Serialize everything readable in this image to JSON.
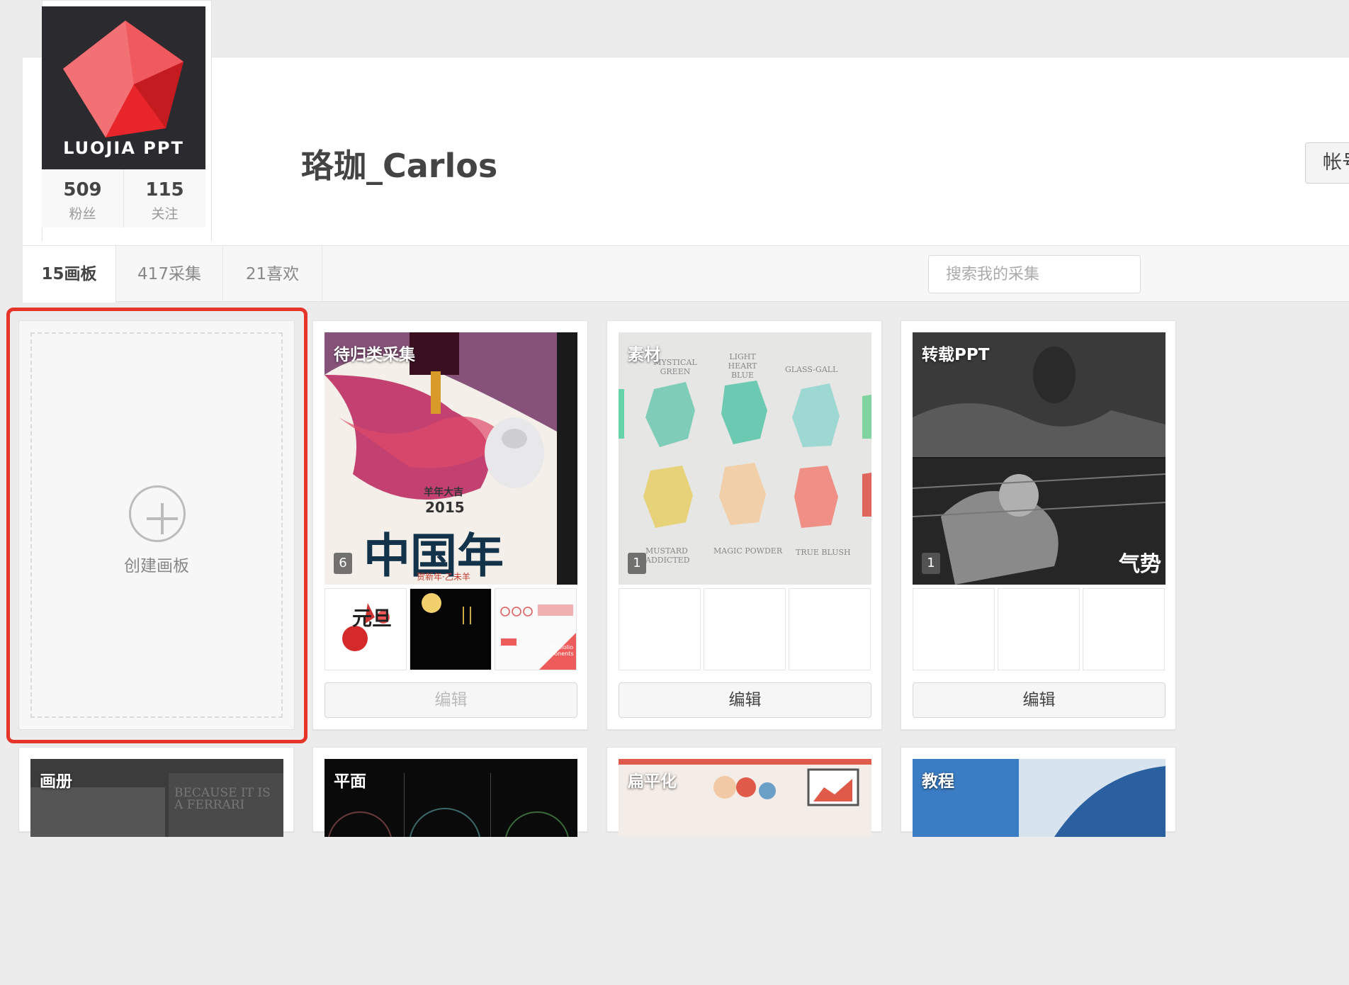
{
  "profile": {
    "username": "珞珈_Carlos",
    "avatar_text": "LUOJIA PPT",
    "followers_count": "509",
    "followers_label": "粉丝",
    "following_count": "115",
    "following_label": "关注",
    "account_button": "帐号设置"
  },
  "tabs": [
    {
      "label": "15画板"
    },
    {
      "label": "417采集"
    },
    {
      "label": "21喜欢"
    }
  ],
  "search": {
    "placeholder": "搜索我的采集"
  },
  "create_board": {
    "label": "创建画板"
  },
  "boards": [
    {
      "title": "待归类采集",
      "count": "6",
      "edit_label": "编辑",
      "edit_disabled": true
    },
    {
      "title": "素材",
      "count": "1",
      "edit_label": "编辑"
    },
    {
      "title": "转载PPT",
      "count": "1",
      "edit_label": "编辑"
    }
  ],
  "boards_row2": [
    {
      "title": "画册",
      "cover_text": "BECAUSE IT IS A FERRARI"
    },
    {
      "title": "平面"
    },
    {
      "title": "扁平化"
    },
    {
      "title": "教程"
    }
  ],
  "cover_texts": {
    "poster_year": "2015",
    "poster_blessing": "羊年大吉",
    "poster_big": "中国年",
    "poster_sub": "贺新年·乙未羊",
    "stones_labels": [
      "MYSTICAL GREEN",
      "LIGHT HEART BLUE",
      "GLASS-GALL",
      "MUSTARD ADDICTED",
      "MAGIC POWDER",
      "TRUE BLUSH"
    ],
    "ppt_overlay": "气势",
    "portfolio_label": "Portfolio Components",
    "thumb_yuandan": "元旦"
  },
  "colors": {
    "highlight": "#e5342a",
    "avatar_bg": "#2b2b2f",
    "avatar_red": "#e8252a"
  }
}
